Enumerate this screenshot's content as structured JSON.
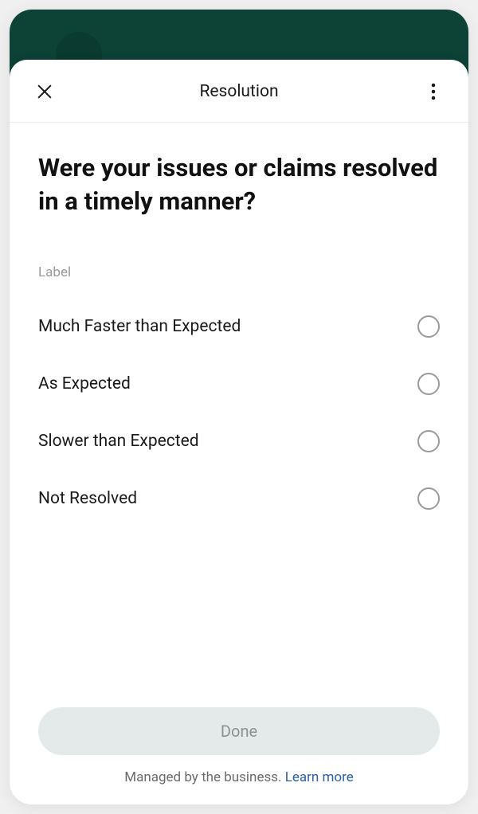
{
  "header": {
    "title": "Resolution"
  },
  "question": "Were your issues or claims resolved in a timely manner?",
  "field_label": "Label",
  "options": [
    {
      "label": "Much Faster than Expected"
    },
    {
      "label": "As Expected"
    },
    {
      "label": "Slower than Expected"
    },
    {
      "label": "Not Resolved"
    }
  ],
  "footer": {
    "done_label": "Done",
    "managed_text": "Managed by the business. ",
    "learn_more": "Learn more"
  }
}
